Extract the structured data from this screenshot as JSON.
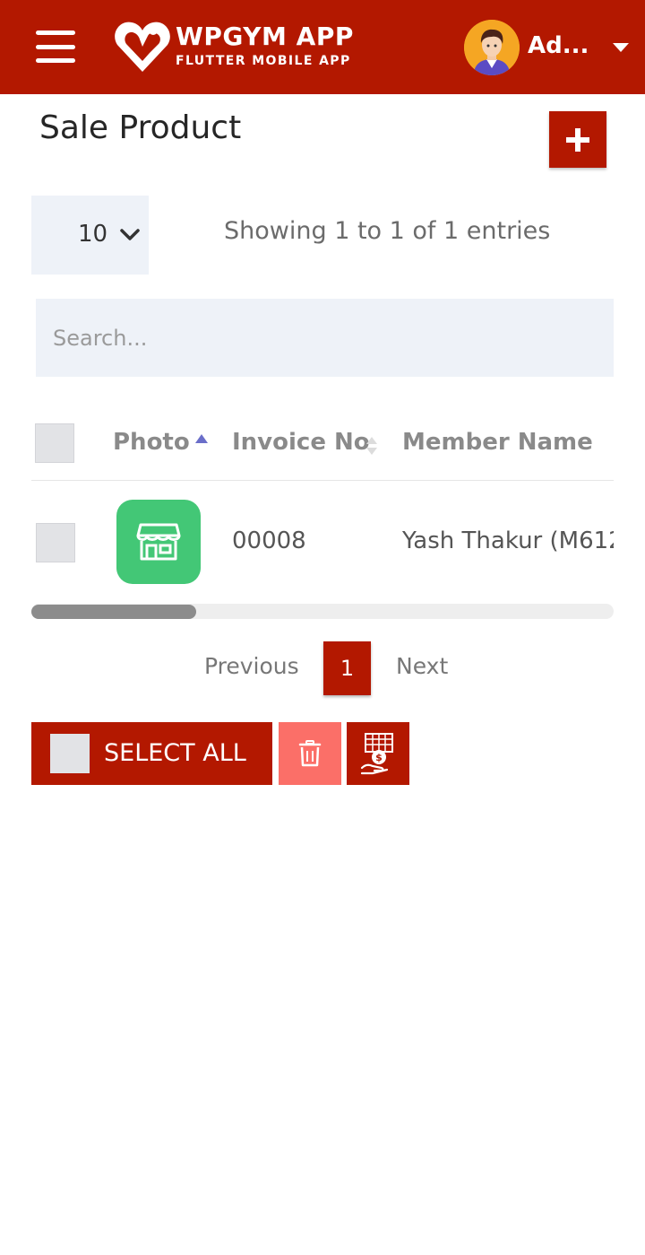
{
  "header": {
    "brand_title": "WPGYM APP",
    "brand_subtitle": "FLUTTER MOBILE APP",
    "user_name": "Ad...",
    "brand_color": "#b31800"
  },
  "page": {
    "title": "Sale Product",
    "add_icon": "plus-icon"
  },
  "table_controls": {
    "page_length": "10",
    "info": "Showing 1 to 1 of 1 entries",
    "search_placeholder": "Search..."
  },
  "table": {
    "columns": [
      "Photo",
      "Invoice No",
      "Member Name"
    ],
    "rows": [
      {
        "photo_icon": "store-icon",
        "invoice_no": "00008",
        "member_name": "Yash Thakur (M612"
      }
    ]
  },
  "pagination": {
    "previous": "Previous",
    "current": "1",
    "next": "Next"
  },
  "bulk_actions": {
    "select_all": "SELECT ALL",
    "delete_icon": "trash-icon",
    "payment_icon": "payment-icon",
    "delete_color": "#fb6f68"
  }
}
